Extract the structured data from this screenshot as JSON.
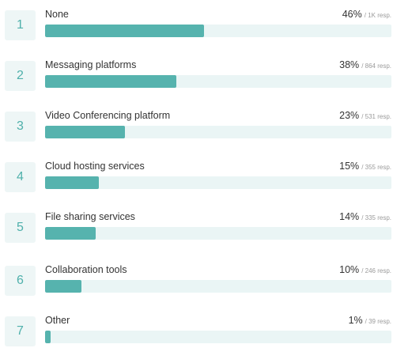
{
  "accent_color": "#56b3ae",
  "track_color": "#eaf5f5",
  "results": [
    {
      "rank": "1",
      "label": "None",
      "percent_text": "46%",
      "responses_text": "/ 1K resp.",
      "fraction": 0.46
    },
    {
      "rank": "2",
      "label": "Messaging platforms",
      "percent_text": "38%",
      "responses_text": "/ 864 resp.",
      "fraction": 0.38
    },
    {
      "rank": "3",
      "label": "Video Conferencing platform",
      "percent_text": "23%",
      "responses_text": "/ 531 resp.",
      "fraction": 0.23
    },
    {
      "rank": "4",
      "label": "Cloud hosting services",
      "percent_text": "15%",
      "responses_text": "/ 355 resp.",
      "fraction": 0.155
    },
    {
      "rank": "5",
      "label": "File sharing services",
      "percent_text": "14%",
      "responses_text": "/ 335 resp.",
      "fraction": 0.145
    },
    {
      "rank": "6",
      "label": "Collaboration tools",
      "percent_text": "10%",
      "responses_text": "/ 246 resp.",
      "fraction": 0.105
    },
    {
      "rank": "7",
      "label": "Other",
      "percent_text": "1%",
      "responses_text": "/ 39 resp.",
      "fraction": 0.016
    }
  ]
}
